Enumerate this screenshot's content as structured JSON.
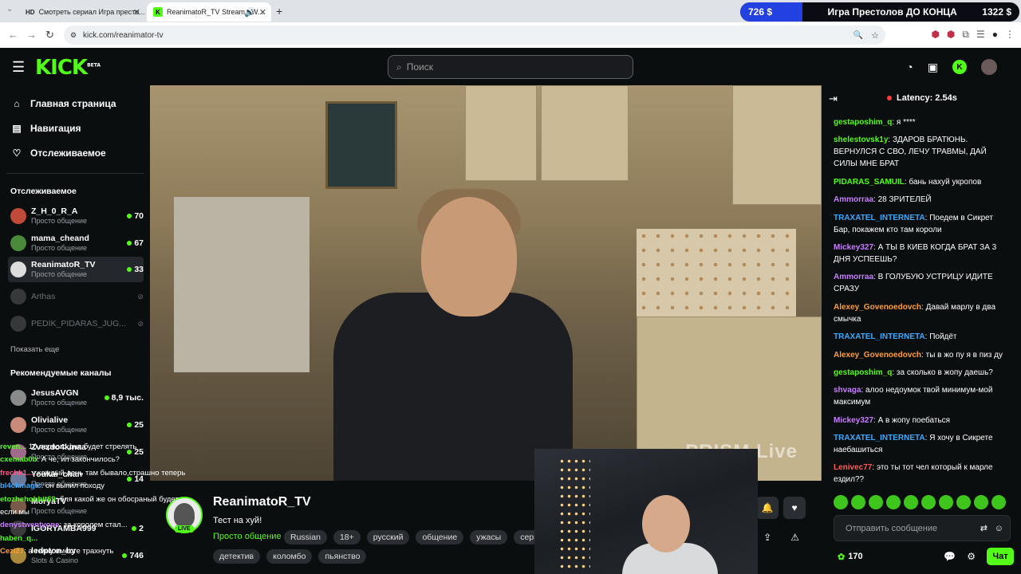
{
  "browser": {
    "tabs": [
      {
        "favicon": "HD",
        "title": "Смотреть сериал Игра престо..."
      },
      {
        "favicon": "K",
        "title": "ReanimatoR_TV Stream - W..."
      }
    ],
    "url": "kick.com/reanimator-tv",
    "banner": {
      "left": "726 $",
      "middle": "Игра Престолов ДО КОНЦА",
      "right": "1322 $"
    }
  },
  "header": {
    "logo": "KICK",
    "logo_badge": "BETA",
    "search_placeholder": "Поиск"
  },
  "sidebar": {
    "nav": [
      {
        "label": "Главная страница",
        "icon": "home-icon"
      },
      {
        "label": "Навигация",
        "icon": "compass-icon"
      },
      {
        "label": "Отслеживаемое",
        "icon": "heart-icon"
      }
    ],
    "following_title": "Отслеживаемое",
    "following": [
      {
        "name": "Z_H_0_R_A",
        "category": "Просто общение",
        "viewers": "70",
        "color": "#c24a3a"
      },
      {
        "name": "mama_cheand",
        "category": "Просто общение",
        "viewers": "67",
        "color": "#4a8a3a"
      },
      {
        "name": "ReanimatoR_TV",
        "category": "Просто общение",
        "viewers": "33",
        "color": "#dddddd"
      },
      {
        "name": "Arthas",
        "category": "",
        "viewers": "",
        "color": "#777777"
      },
      {
        "name": "PEDIK_PIDARAS_JUG...",
        "category": "",
        "viewers": "",
        "color": "#777777"
      }
    ],
    "show_more": "Показать еще",
    "recommended_title": "Рекомендуемые каналы",
    "recommended": [
      {
        "name": "JesusAVGN",
        "category": "Просто общение",
        "viewers": "8,9 тыс.",
        "color": "#8a8a8a"
      },
      {
        "name": "Olivialive",
        "category": "Просто общение",
        "viewers": "25",
        "color": "#c98a7a"
      },
      {
        "name": "Zvezdo4kinaa",
        "category": "Просто общение",
        "viewers": "25",
        "color": "#a06a8a"
      },
      {
        "name": "Youkai_chan",
        "category": "Просто общение",
        "viewers": "14",
        "color": "#6a7a9a"
      },
      {
        "name": "MoryaTV",
        "category": "Просто общение",
        "viewers": "",
        "color": "#7a5a4a"
      },
      {
        "name": "IGORYAMBA999",
        "category": "",
        "viewers": "2",
        "color": "#3a3a3a"
      },
      {
        "name": "ledpton_by",
        "category": "Slots & Casino",
        "viewers": "746",
        "color": "#aa8a3a"
      }
    ]
  },
  "chat_overlay": [
    {
      "user": "reven...",
      "text": "10 первого дня будет стрелять"
    },
    {
      "user": "cxemab0b",
      "text": ": А че, ип закончилось?"
    },
    {
      "user": "frechk1...",
      "text": ": каждый день там бывало,страшно теперь"
    },
    {
      "user": "bl4ckmagic",
      "text": ": он выпил походу"
    },
    {
      "user": "etozhehobbit69",
      "text": ": бля какой же он обосраный будет если мы"
    },
    {
      "user": "denystwentyone",
      "text": ": за королем стал..."
    },
    {
      "user": "haben_q...",
      "text": ""
    },
    {
      "user": "Cezi27",
      "text": ": а телку вместе трахнуть"
    }
  ],
  "video": {
    "watermark": "PRISM Live"
  },
  "stream": {
    "streamer": "ReanimatoR_TV",
    "live_label": "LIVE",
    "title": "Тест на хуй!",
    "category": "Просто общение",
    "tags_row1": [
      "Russian",
      "18+",
      "русский",
      "общение",
      "ужасы",
      "сериалы"
    ],
    "tags_row2": [
      "детектив",
      "коломбо",
      "пьянство"
    ]
  },
  "chat": {
    "latency": "Latency: 2.54s",
    "messages": [
      {
        "user": "gestaposhim_q",
        "color": "#53fc18",
        "text": "я ****"
      },
      {
        "user": "shelestovsk1y",
        "color": "#53fc18",
        "text": "ЗДАРОВ БРАТЮНЬ. ВЕРНУЛСЯ С СВО, ЛЕЧУ ТРАВМЫ, ДАЙ СИЛЫ МНЕ БРАТ"
      },
      {
        "user": "PIDARAS_SAMUIL",
        "color": "#53fc18",
        "text": "бань нахуй укропов"
      },
      {
        "user": "Ammorraa",
        "color": "#c77dff",
        "text": "28 ЗРИТЕЛЕЙ"
      },
      {
        "user": "TRAXATEL_INTERNETA",
        "color": "#3da9ff",
        "text": "Поедем в Сикрет Бар, покажем кто там короли"
      },
      {
        "user": "Mickey327",
        "color": "#c77dff",
        "text": "А ТЫ В КИЕВ КОГДА БРАТ ЗА 3 ДНЯ УСПЕЕШЬ?"
      },
      {
        "user": "Ammorraa",
        "color": "#c77dff",
        "text": "В ГОЛУБУЮ УСТРИЦУ ИДИТЕ СРАЗУ"
      },
      {
        "user": "Alexey_Govenoedovch",
        "color": "#ff9d3a",
        "text": "Давай марлу в два смычка"
      },
      {
        "user": "TRAXATEL_INTERNETA",
        "color": "#3da9ff",
        "text": "Пойдёт"
      },
      {
        "user": "Alexey_Govenoedovch",
        "color": "#ff9d3a",
        "text": "ты в жо пу я в пиз ду"
      },
      {
        "user": "gestaposhim_q",
        "color": "#53fc18",
        "text": "за сколько в жопу даешь?"
      },
      {
        "user": "shvaga",
        "color": "#c77dff",
        "text": "алоо недоумок твой минимум-мой максимум"
      },
      {
        "user": "Mickey327",
        "color": "#c77dff",
        "text": "А в жопу поебаться"
      },
      {
        "user": "TRAXATEL_INTERNETA",
        "color": "#3da9ff",
        "text": "Я хочу в Сикрете наебашиться"
      },
      {
        "user": "Lenivec77",
        "color": "#ff5a5a",
        "text": "это ты тот чел который к марле ездил??"
      }
    ],
    "input_placeholder": "Отправить сообщение",
    "points": "170",
    "send_label": "Чат"
  },
  "colors": {
    "accent": "#53fc18",
    "background": "#0b0e0f"
  }
}
